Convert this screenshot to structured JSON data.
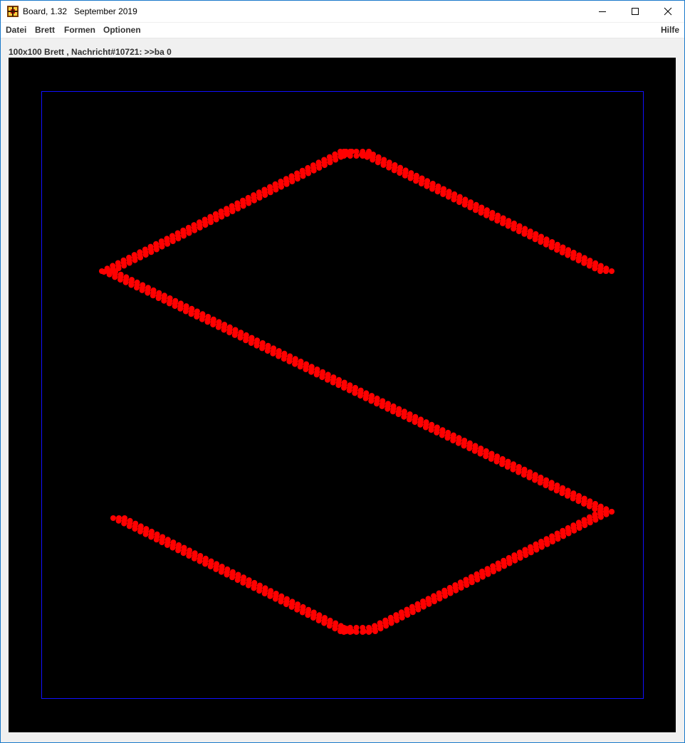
{
  "window": {
    "title": "Board, 1.32   September 2019",
    "icon": "board-app-icon"
  },
  "controls": {
    "minimize_icon": "minimize-icon",
    "maximize_icon": "maximize-icon",
    "close_icon": "close-icon"
  },
  "menu": {
    "items": [
      "Datei",
      "Brett",
      "Formen",
      "Optionen"
    ],
    "help": "Hilfe"
  },
  "status": {
    "text": "100x100 Brett , Nachricht#10721: >>ba 0"
  },
  "board": {
    "size": "100x100",
    "background_color": "#000000",
    "frame_color": "#1010ff",
    "dot_color": "#ff0000",
    "shape": "S-shaped dot pattern"
  }
}
